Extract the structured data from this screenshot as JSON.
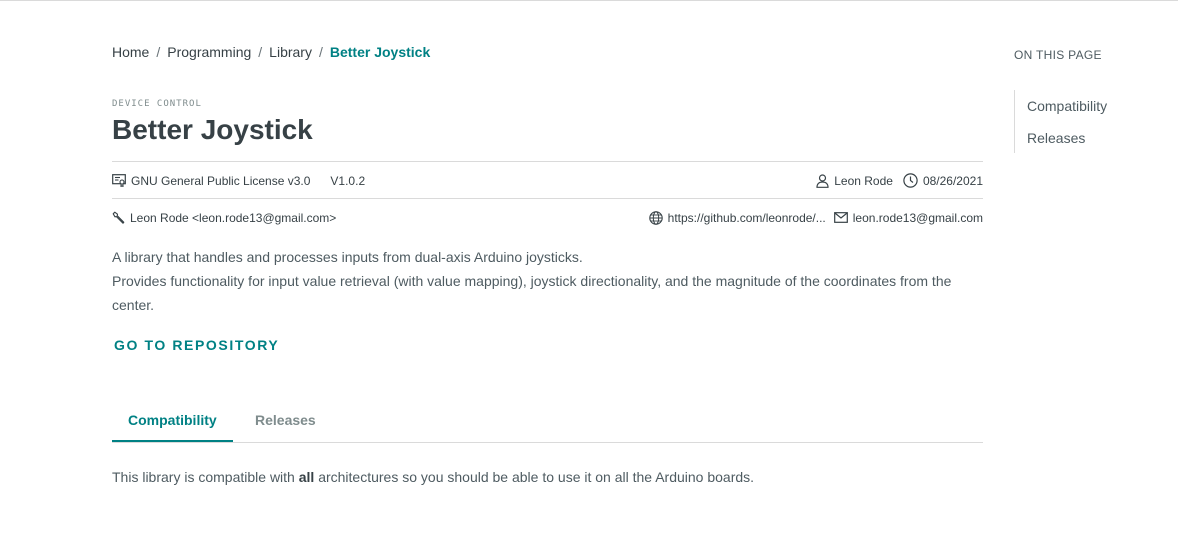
{
  "breadcrumb": {
    "items": [
      "Home",
      "Programming",
      "Library",
      "Better Joystick"
    ],
    "separator": "/"
  },
  "library": {
    "category": "DEVICE CONTROL",
    "title": "Better Joystick",
    "license": "GNU General Public License v3.0",
    "version": "V1.0.2",
    "author": "Leon Rode",
    "date": "08/26/2021",
    "maintainer": "Leon Rode <leon.rode13@gmail.com>",
    "website": "https://github.com/leonrode/...",
    "email": "leon.rode13@gmail.com",
    "description": [
      "A library that handles and processes inputs from dual-axis Arduino joysticks.",
      "Provides functionality for input value retrieval (with value mapping), joystick directionality, and the magnitude of the coordinates from the center."
    ],
    "repo_button": "GO TO REPOSITORY"
  },
  "tabs": [
    {
      "label": "Compatibility",
      "active": true
    },
    {
      "label": "Releases",
      "active": false
    }
  ],
  "compatibility": {
    "before": "This library is compatible with ",
    "emphasis": "all",
    "after": " architectures so you should be able to use it on all the Arduino boards."
  },
  "toc": {
    "title": "ON THIS PAGE",
    "items": [
      "Compatibility",
      "Releases"
    ]
  },
  "colors": {
    "accent": "#008184",
    "text_dark": "#374146",
    "text": "#4e5b61",
    "divider": "#dadada"
  },
  "icons": {
    "license": "license-icon",
    "author": "user-icon",
    "date": "clock-icon",
    "maintainer": "wrench-icon",
    "website": "globe-icon",
    "email": "mail-icon"
  }
}
